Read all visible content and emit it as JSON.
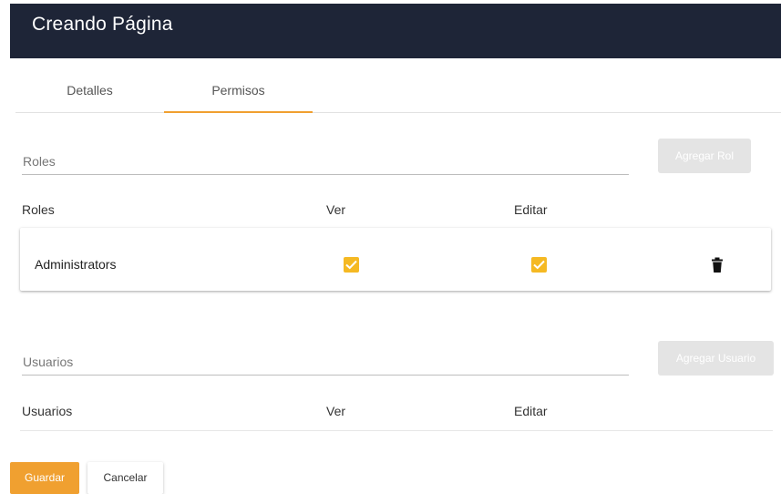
{
  "header": {
    "title": "Creando Página"
  },
  "tabs": [
    {
      "label": "Detalles",
      "active": false
    },
    {
      "label": "Permisos",
      "active": true
    }
  ],
  "roles_section": {
    "input_placeholder": "Roles",
    "add_button": "Agregar Rol",
    "columns": [
      "Roles",
      "Ver",
      "Editar"
    ],
    "rows": [
      {
        "name": "Administrators",
        "ver": true,
        "editar": true
      }
    ]
  },
  "users_section": {
    "input_placeholder": "Usuarios",
    "add_button": "Agregar Usuario",
    "columns": [
      "Usuarios",
      "Ver",
      "Editar"
    ]
  },
  "footer": {
    "save_label": "Guardar",
    "cancel_label": "Cancelar"
  },
  "colors": {
    "header_bg": "#1e2537",
    "accent": "#f0a030",
    "checkbox": "#f5b923",
    "disabled_button": "#e4e4e4"
  },
  "icons": {
    "checkbox_checked": "check-icon",
    "delete": "trash-icon"
  }
}
